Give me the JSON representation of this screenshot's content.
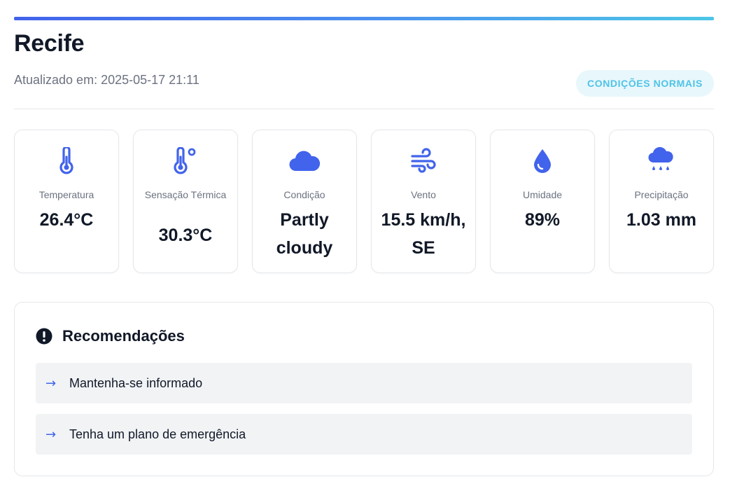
{
  "header": {
    "city": "Recife",
    "updated": "Atualizado em: 2025-05-17 21:11",
    "status_badge": "CONDIÇÕES NORMAIS"
  },
  "colors": {
    "accent": "#4263eb",
    "badge_text": "#4fc3e6",
    "badge_bg": "#e8f7fc"
  },
  "metrics": [
    {
      "icon": "thermometer-icon",
      "label": "Temperatura",
      "value": "26.4°C"
    },
    {
      "icon": "thermometer-feels-like-icon",
      "label": "Sensação Térmica",
      "value": "30.3°C"
    },
    {
      "icon": "cloud-icon",
      "label": "Condição",
      "value": "Partly cloudy"
    },
    {
      "icon": "wind-icon",
      "label": "Vento",
      "value": "15.5 km/h, SE"
    },
    {
      "icon": "droplet-icon",
      "label": "Umidade",
      "value": "89%"
    },
    {
      "icon": "cloud-rain-icon",
      "label": "Precipitação",
      "value": "1.03 mm"
    }
  ],
  "recommendations": {
    "title": "Recomendações",
    "icon": "exclamation-circle-icon",
    "items": [
      {
        "arrow": "→",
        "text": "Mantenha-se informado"
      },
      {
        "arrow": "→",
        "text": "Tenha um plano de emergência"
      }
    ]
  }
}
